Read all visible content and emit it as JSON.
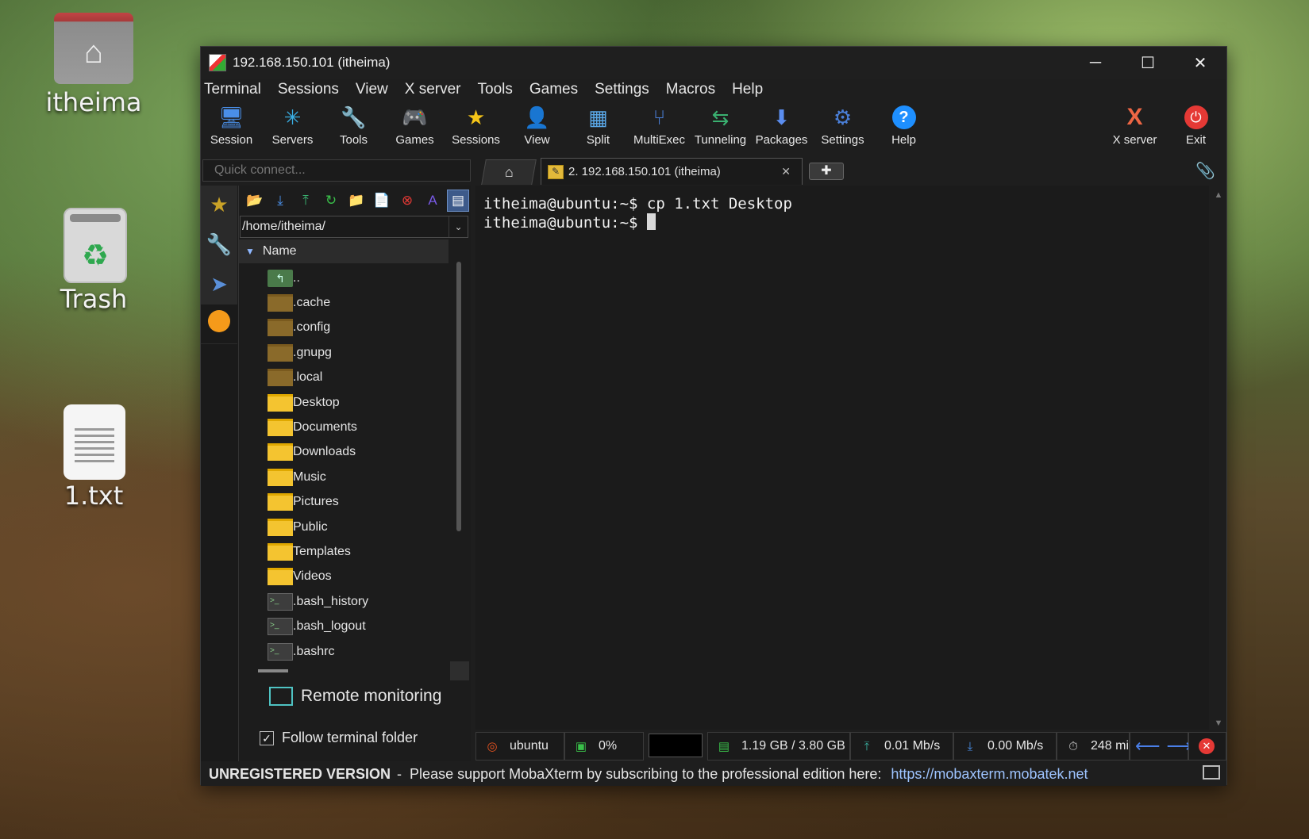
{
  "desktop": {
    "icons": [
      {
        "label": "itheima"
      },
      {
        "label": "Trash"
      },
      {
        "label": "1.txt"
      }
    ]
  },
  "window": {
    "title": "192.168.150.101 (itheima)",
    "controls": {
      "minimize": "─",
      "maximize": "☐",
      "close": "✕"
    }
  },
  "menu": [
    "Terminal",
    "Sessions",
    "View",
    "X server",
    "Tools",
    "Games",
    "Settings",
    "Macros",
    "Help"
  ],
  "toolbar": {
    "items": [
      {
        "label": "Session",
        "icon": "session-icon"
      },
      {
        "label": "Servers",
        "icon": "servers-icon"
      },
      {
        "label": "Tools",
        "icon": "tools-icon"
      },
      {
        "label": "Games",
        "icon": "games-icon"
      },
      {
        "label": "Sessions",
        "icon": "star-icon"
      },
      {
        "label": "View",
        "icon": "view-icon"
      },
      {
        "label": "Split",
        "icon": "split-icon"
      },
      {
        "label": "MultiExec",
        "icon": "multiexec-icon"
      },
      {
        "label": "Tunneling",
        "icon": "tunneling-icon"
      },
      {
        "label": "Packages",
        "icon": "packages-icon"
      },
      {
        "label": "Settings",
        "icon": "settings-icon"
      },
      {
        "label": "Help",
        "icon": "help-icon"
      }
    ],
    "right": [
      {
        "label": "X server",
        "icon": "xserver-icon"
      },
      {
        "label": "Exit",
        "icon": "power-icon"
      }
    ]
  },
  "tabs": {
    "quick_connect_placeholder": "Quick connect...",
    "session_tab": "2. 192.168.150.101 (itheima)"
  },
  "sftp": {
    "path": "/home/itheima/",
    "column": "Name",
    "files": [
      {
        "name": "..",
        "type": "up"
      },
      {
        "name": ".cache",
        "type": "hidden"
      },
      {
        "name": ".config",
        "type": "hidden"
      },
      {
        "name": ".gnupg",
        "type": "hidden"
      },
      {
        "name": ".local",
        "type": "hidden"
      },
      {
        "name": "Desktop",
        "type": "folder"
      },
      {
        "name": "Documents",
        "type": "folder"
      },
      {
        "name": "Downloads",
        "type": "folder"
      },
      {
        "name": "Music",
        "type": "folder"
      },
      {
        "name": "Pictures",
        "type": "folder"
      },
      {
        "name": "Public",
        "type": "folder"
      },
      {
        "name": "Templates",
        "type": "folder"
      },
      {
        "name": "Videos",
        "type": "folder"
      },
      {
        "name": ".bash_history",
        "type": "file"
      },
      {
        "name": ".bash_logout",
        "type": "file"
      },
      {
        "name": ".bashrc",
        "type": "file"
      }
    ],
    "remote_monitoring": "Remote monitoring",
    "follow_terminal_folder": "Follow terminal folder"
  },
  "terminal": {
    "lines": [
      "itheima@ubuntu:~$ cp 1.txt Desktop",
      "itheima@ubuntu:~$ "
    ]
  },
  "status": {
    "host": "ubuntu",
    "cpu": "0%",
    "memory": "1.19 GB / 3.80 GB",
    "upload": "0.01 Mb/s",
    "download": "0.00 Mb/s",
    "uptime": "248 mi"
  },
  "banner": {
    "unregistered": "UNREGISTERED VERSION",
    "separator": "-",
    "message": "Please support MobaXterm by subscribing to the professional edition here:",
    "link": "https://mobaxterm.mobatek.net"
  },
  "colors": {
    "folder": "#f4c430",
    "accent": "#3d5a8a",
    "link": "#9ec4ff"
  }
}
